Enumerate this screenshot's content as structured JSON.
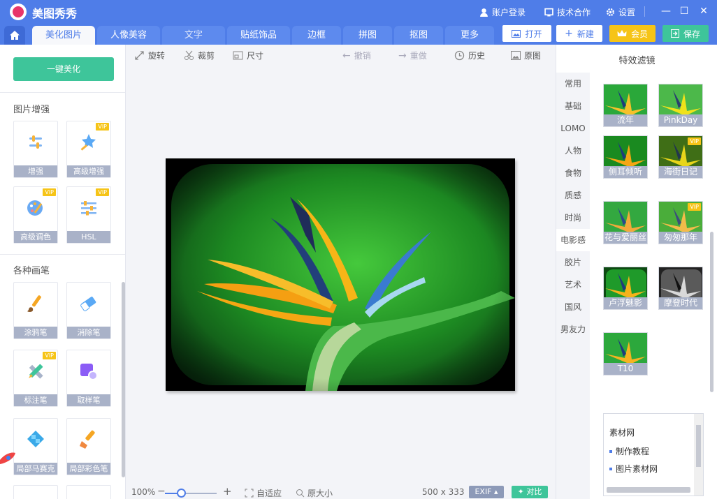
{
  "app": {
    "title": "美图秀秀"
  },
  "titlebar": {
    "login": "账户登录",
    "cooperation": "技术合作",
    "settings": "设置"
  },
  "tabs": [
    {
      "label": "美化图片"
    },
    {
      "label": "人像美容"
    },
    {
      "label": "文字"
    },
    {
      "label": "贴纸饰品"
    },
    {
      "label": "边框"
    },
    {
      "label": "拼图"
    },
    {
      "label": "抠图"
    },
    {
      "label": "更多"
    }
  ],
  "actions": {
    "open": "打开",
    "new": "新建",
    "vip": "会员",
    "save": "保存"
  },
  "left": {
    "one_key": "一键美化",
    "enhance_title": "图片增强",
    "enhance_tools": [
      {
        "label": "增强",
        "vip": ""
      },
      {
        "label": "高级增强",
        "vip": "VIP"
      },
      {
        "label": "高级调色",
        "vip": "VIP"
      },
      {
        "label": "HSL",
        "vip": "VIP"
      }
    ],
    "brush_title": "各种画笔",
    "brush_tools": [
      {
        "label": "涂鸦笔",
        "vip": ""
      },
      {
        "label": "消除笔",
        "vip": ""
      },
      {
        "label": "标注笔",
        "vip": "VIP"
      },
      {
        "label": "取样笔",
        "vip": ""
      },
      {
        "label": "局部马赛克",
        "vip": ""
      },
      {
        "label": "局部彩色笔",
        "vip": ""
      }
    ]
  },
  "center": {
    "toolbar": {
      "rotate": "旋转",
      "crop": "裁剪",
      "size": "尺寸",
      "undo": "撤销",
      "redo": "重做",
      "history": "历史",
      "original": "原图"
    },
    "zoom": "100%",
    "fit": "自适应",
    "actual": "原大小",
    "dimensions": "500 x 333",
    "exif": "EXIF",
    "compare": "对比"
  },
  "right": {
    "title": "特效滤镜",
    "categories": [
      "常用",
      "基础",
      "LOMO",
      "人物",
      "食物",
      "质感",
      "时尚",
      "电影感",
      "胶片",
      "艺术",
      "国风",
      "男友力"
    ],
    "active_category": "电影感",
    "filters": [
      {
        "label": "流年",
        "vip": ""
      },
      {
        "label": "PinkDay",
        "vip": ""
      },
      {
        "label": "侧耳倾听",
        "vip": ""
      },
      {
        "label": "海街日记",
        "vip": "VIP"
      },
      {
        "label": "花与爱丽丝",
        "vip": ""
      },
      {
        "label": "匆匆那年",
        "vip": "VIP"
      },
      {
        "label": "卢浮魅影",
        "vip": ""
      },
      {
        "label": "摩登时代",
        "vip": ""
      },
      {
        "label": "T10",
        "vip": ""
      }
    ],
    "ad_items": [
      "素材网",
      "制作教程",
      "图片素材网"
    ]
  },
  "colors": {
    "brand": "#4f7de8",
    "green": "#3ec59a",
    "vip": "#f6c417"
  }
}
